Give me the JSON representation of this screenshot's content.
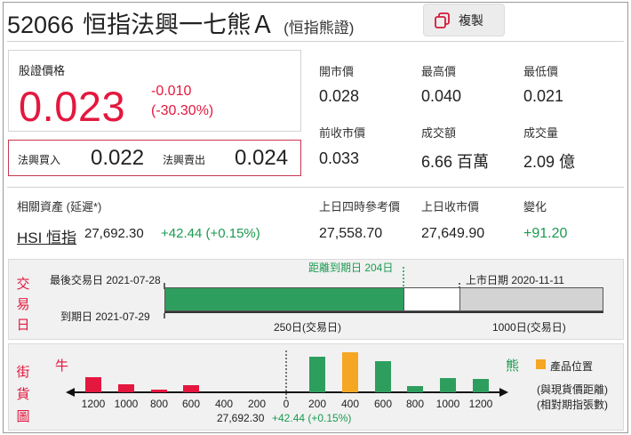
{
  "header": {
    "code": "52066",
    "name": "恒指法興一七熊Ａ",
    "type_label": "(恒指熊證)",
    "copy_label": "複製",
    "copy_icon": "copy-icon"
  },
  "price": {
    "label": "股證價格",
    "value": "0.023",
    "change": "-0.010",
    "change_pct": "(-30.30%)",
    "bid_label": "法興買入",
    "bid": "0.022",
    "ask_label": "法興賣出",
    "ask": "0.024"
  },
  "stats": {
    "open_label": "開市價",
    "open": "0.028",
    "high_label": "最高價",
    "high": "0.040",
    "low_label": "最低價",
    "low": "0.021",
    "prev_close_label": "前收市價",
    "prev_close": "0.033",
    "turnover_label": "成交額",
    "turnover": "6.66 百萬",
    "volume_label": "成交量",
    "volume": "2.09 億"
  },
  "underlying": {
    "label": "相關資產 (延遲*)",
    "name": "HSI 恒指",
    "price": "27,692.30",
    "change": "+42.44 (+0.15%)",
    "ref_label": "上日四時參考價",
    "ref": "27,558.70",
    "prev_close_label": "上日收市價",
    "prev_close": "27,649.90",
    "diff_label": "變化",
    "diff": "+91.20"
  },
  "trading_days": {
    "section_label": [
      "交",
      "易",
      "日"
    ],
    "last_trade": "最後交易日 2021-07-28",
    "expiry": "到期日 2021-07-29",
    "to_expiry": "距離到期日 204日",
    "listing": "上市日期 2020-11-11",
    "seg1_label": "250日(交易日)",
    "seg2_label": "1000日(交易日)"
  },
  "bull_bear": {
    "section_label": [
      "街",
      "貨",
      "圖"
    ],
    "bull_label": "牛",
    "bear_label": "熊",
    "legend_label": "產品位置",
    "note1": "(與現貨價距離)",
    "note2": "(相對期指張數)",
    "center_price": "27,692.30",
    "center_change": "+42.44 (+0.15%)",
    "ticks": [
      "1200",
      "1000",
      "800",
      "600",
      "400",
      "200",
      "0",
      "200",
      "400",
      "600",
      "800",
      "1000",
      "1200"
    ],
    "colors": {
      "bull": "#e4173e",
      "bear": "#2e9e5e",
      "highlight": "#f5a623"
    }
  },
  "chart_data": {
    "type": "bar",
    "categories": [
      "1200",
      "1000",
      "800",
      "600",
      "400",
      "200",
      "200",
      "400",
      "600",
      "800",
      "1000",
      "1200"
    ],
    "series": [
      {
        "name": "牛",
        "values": [
          17,
          9,
          3,
          8,
          0,
          0,
          null,
          null,
          null,
          null,
          null,
          null
        ]
      },
      {
        "name": "熊",
        "values": [
          null,
          null,
          null,
          null,
          null,
          null,
          40,
          45,
          35,
          7,
          16,
          15
        ]
      }
    ],
    "highlight_index": 7
  }
}
